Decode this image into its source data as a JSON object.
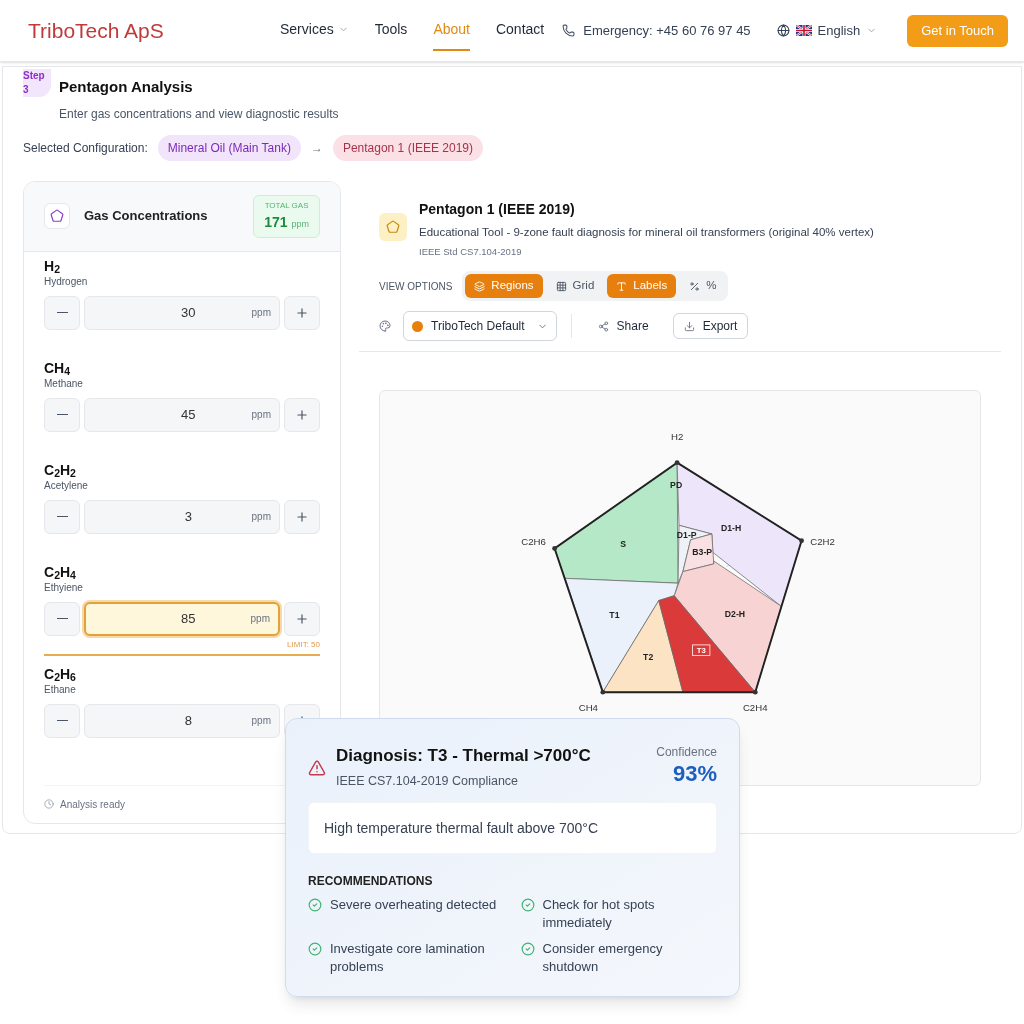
{
  "header": {
    "logo": "TriboTech ApS",
    "nav": [
      {
        "label": "Services",
        "dropdown": true,
        "selected": false
      },
      {
        "label": "Tools",
        "dropdown": false,
        "selected": false
      },
      {
        "label": "About",
        "dropdown": false,
        "selected": true
      },
      {
        "label": "Contact",
        "dropdown": false,
        "selected": false
      }
    ],
    "emergency": "Emergency: +45 60 76 97 45",
    "language": "English",
    "cta": "Get in Touch"
  },
  "step": {
    "badge": "Step 3",
    "title": "Pentagon Analysis",
    "subtitle": "Enter gas concentrations and view diagnostic results"
  },
  "configuration": {
    "label": "Selected Configuration:",
    "oil": "Mineral Oil (Main Tank)",
    "arrow": "→",
    "method": "Pentagon 1 (IEEE 2019)"
  },
  "gas_panel": {
    "title": "Gas Concentrations",
    "total_label": "TOTAL GAS",
    "total_value": "171",
    "total_unit": "ppm",
    "status": "Analysis ready",
    "gases": [
      {
        "formula": "H$_{2}$",
        "name": "Hydrogen",
        "value": "30",
        "unit": "ppm",
        "warning": false
      },
      {
        "formula": "CH$_{4}$",
        "name": "Methane",
        "value": "45",
        "unit": "ppm",
        "warning": false
      },
      {
        "formula": "C$_{2}$H$_{2}$",
        "name": "Acetylene",
        "value": "3",
        "unit": "ppm",
        "warning": false
      },
      {
        "formula": "C$_{2}$H$_{4}$",
        "name": "Ethyiene",
        "value": "85",
        "unit": "ppm",
        "warning": true,
        "limit": "LIMIT: 50"
      },
      {
        "formula": "C$_{2}$H$_{6}$",
        "name": "Ethane",
        "value": "8",
        "unit": "ppm",
        "warning": false
      }
    ]
  },
  "method_panel": {
    "title": "Pentagon 1 (IEEE 2019)",
    "description": "Educational Tool - 9-zone fault diagnosis for mineral oil transformers (original 40% vertex)",
    "standard": "IEEE Std CS7.104-2019",
    "view_options_label": "VIEW OPTIONS",
    "view_options": [
      {
        "kind": "regions",
        "label": "Regions",
        "on": true
      },
      {
        "kind": "grid",
        "label": "Grid",
        "on": false
      },
      {
        "kind": "labels",
        "label": "Labels",
        "on": true
      },
      {
        "kind": "percent",
        "label": "%",
        "on": false
      }
    ],
    "palette": "TriboTech Default",
    "share": "Share",
    "export": "Export"
  },
  "diagram": {
    "vertices": [
      "H2",
      "C2H2",
      "C2H4",
      "CH4",
      "C2H6"
    ],
    "regions": [
      {
        "label": "S",
        "color": "#b4e8c6",
        "selected": false
      },
      {
        "label": "D1-H",
        "color": "#ede5fa",
        "selected": false
      },
      {
        "label": "D1-P",
        "color": "#eef1f6",
        "selected": false
      },
      {
        "label": "B3-P",
        "color": "#f9e1e3",
        "selected": false
      },
      {
        "label": "D2-H",
        "color": "#f8d3d3",
        "selected": false
      },
      {
        "label": "T1",
        "color": "#ebf1fa",
        "selected": false
      },
      {
        "label": "T2",
        "color": "#fbe3c4",
        "selected": false
      },
      {
        "label": "T3",
        "color": "#da3a3a",
        "selected": true
      },
      {
        "label": "PD",
        "selected": false
      }
    ]
  },
  "diagnosis": {
    "title": "Diagnosis: T3 - Thermal >700°C",
    "standard": "IEEE CS7.104-2019 Compliance",
    "confidence_label": "Confidence",
    "confidence": "93%",
    "description": "High temperature thermal fault above 700°C",
    "recommendations_title": "RECOMMENDATIONS",
    "recommendations": [
      "Severe overheating detected",
      "Check for hot spots immediately",
      "Investigate core lamination problems",
      "Consider emergency shutdown"
    ]
  }
}
